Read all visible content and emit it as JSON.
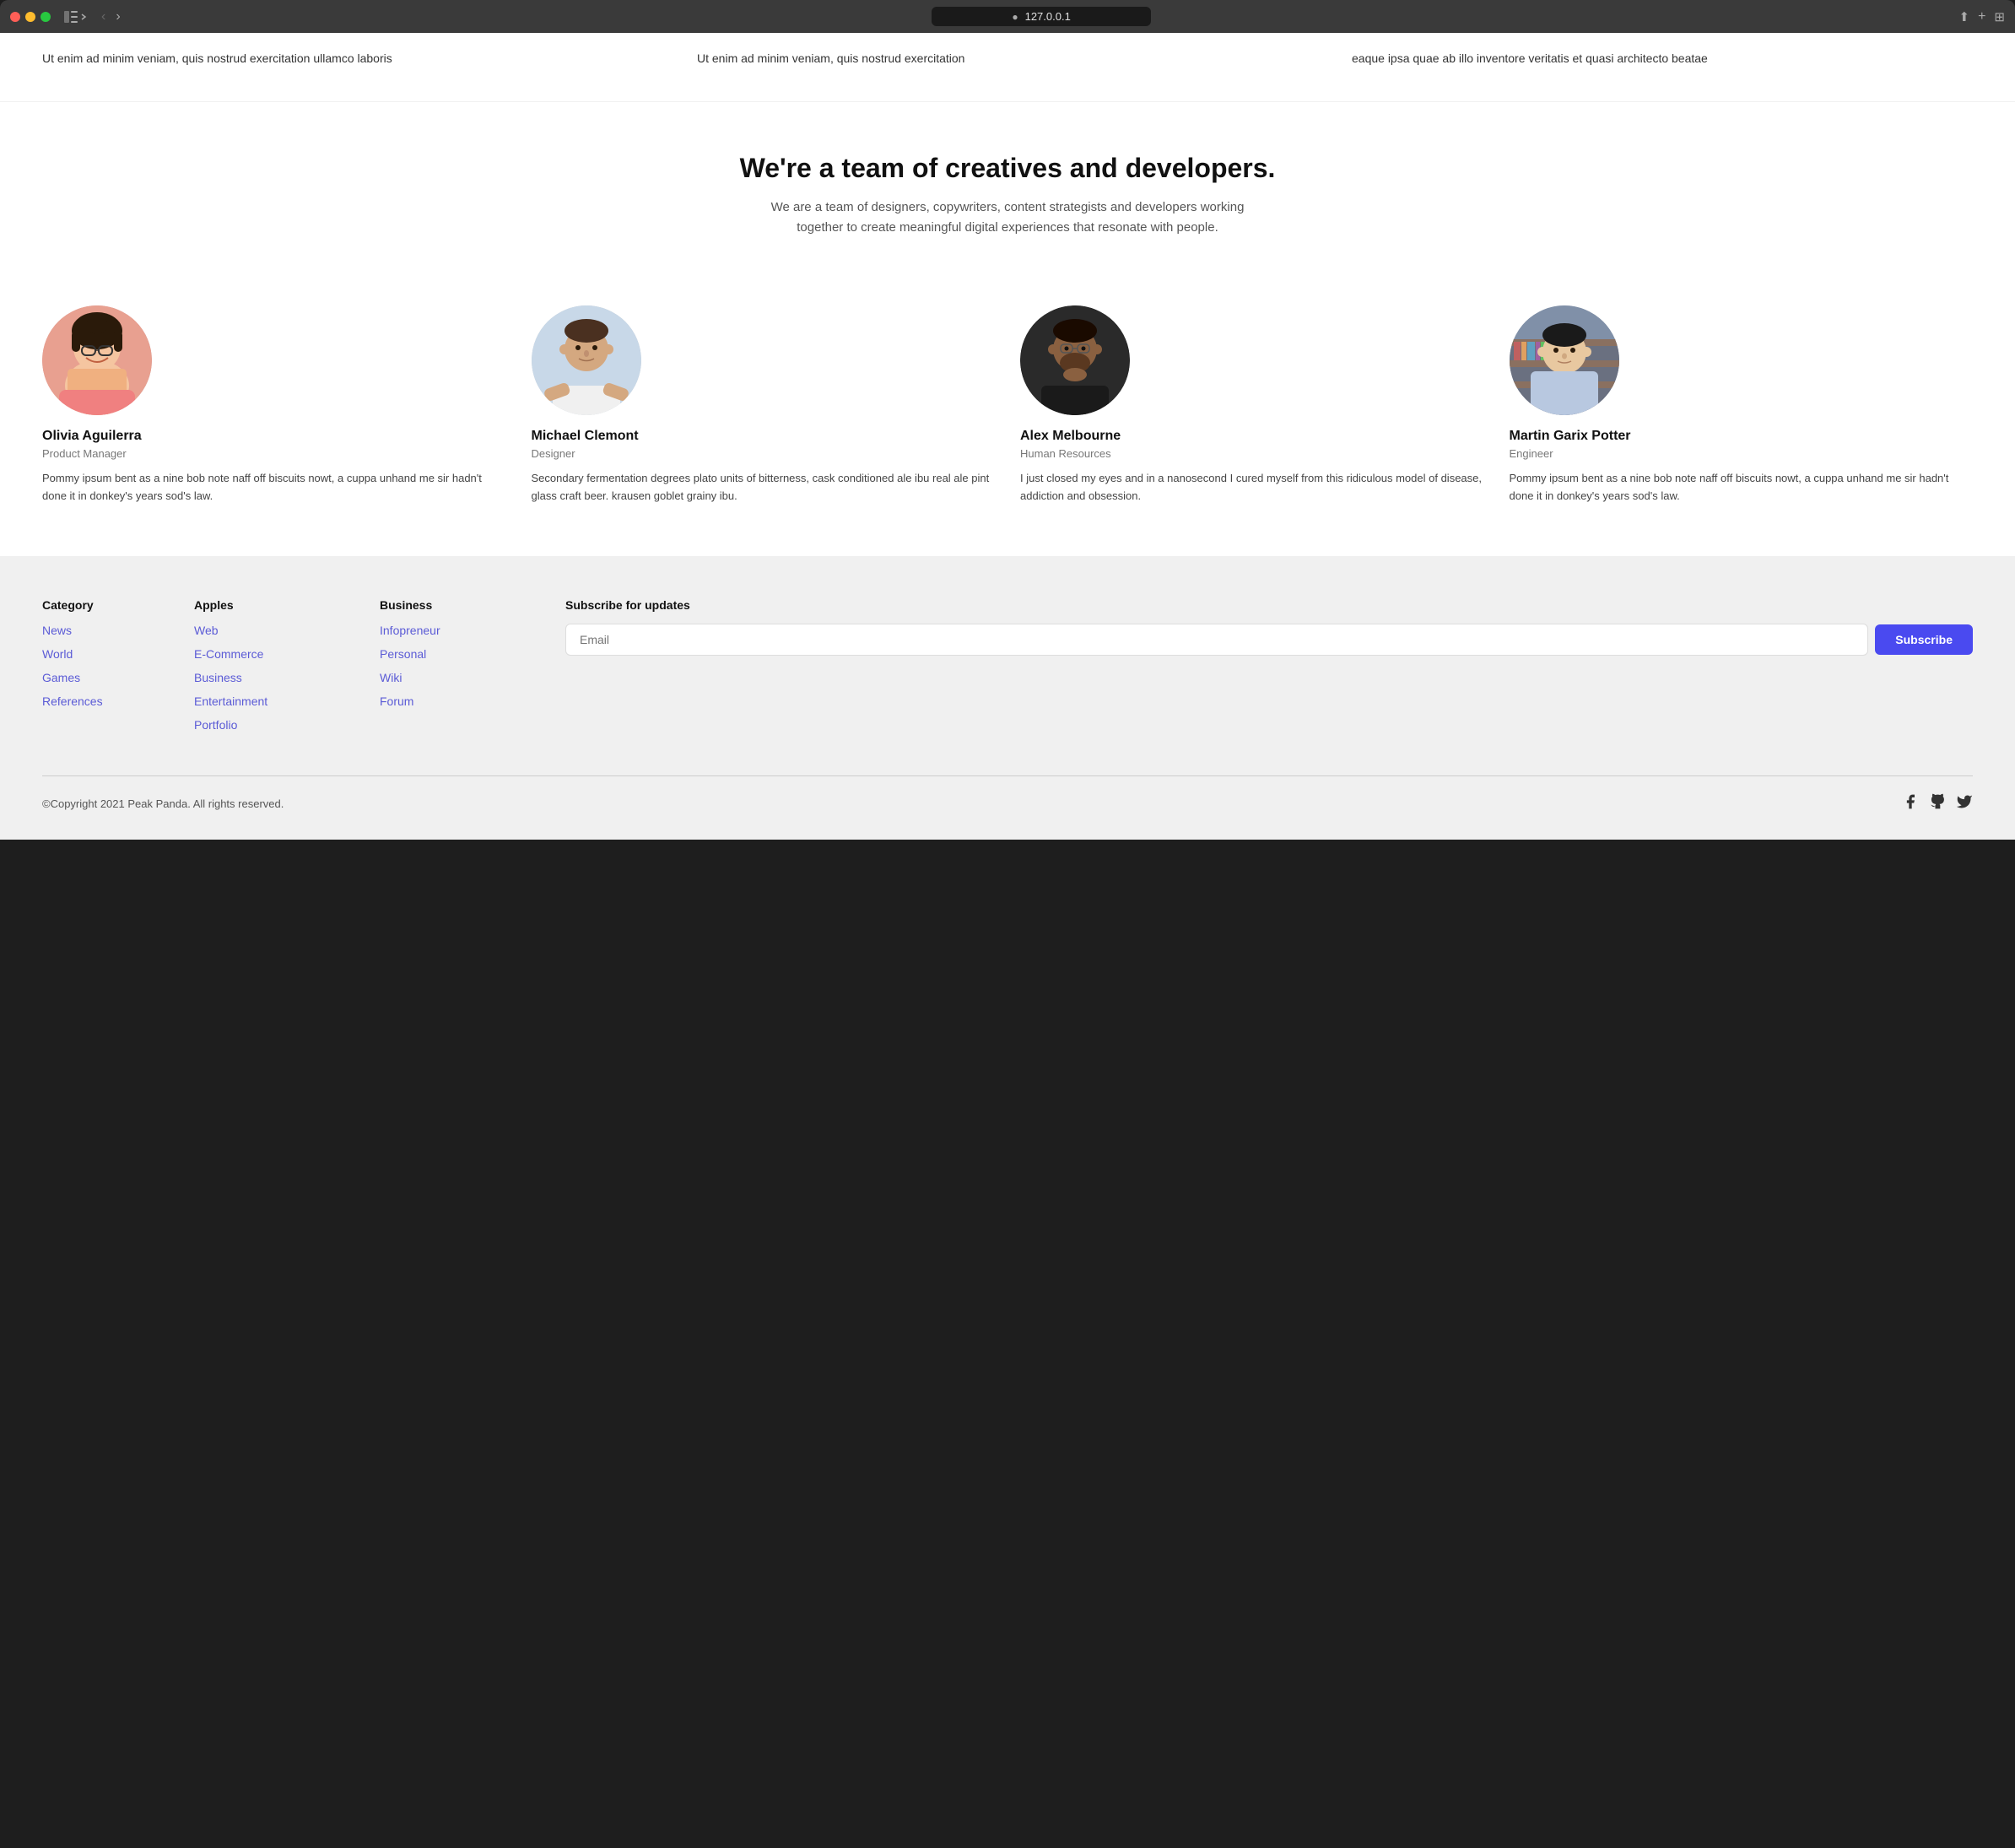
{
  "browser": {
    "url": "127.0.0.1",
    "traffic_lights": [
      "close",
      "minimize",
      "maximize"
    ]
  },
  "top_section": {
    "items": [
      {
        "text": "Ut enim ad minim veniam, quis nostrud exercitation ullamco laboris"
      },
      {
        "text": "Ut enim ad minim veniam, quis nostrud exercitation"
      },
      {
        "text": "eaque ipsa quae ab illo inventore veritatis et quasi architecto beatae"
      }
    ]
  },
  "team_section": {
    "heading": "We're a team of creatives and developers.",
    "subtitle": "We are a team of designers, copywriters, content strategists and developers working together to create meaningful digital experiences that resonate with people.",
    "members": [
      {
        "name": "Olivia Aguilerra",
        "role": "Product Manager",
        "bio": "Pommy ipsum bent as a nine bob note naff off biscuits nowt, a cuppa unhand me sir hadn't done it in donkey's years sod's law.",
        "avatar_class": "avatar-olivia",
        "initials": ""
      },
      {
        "name": "Michael Clemont",
        "role": "Designer",
        "bio": "Secondary fermentation degrees plato units of bitterness, cask conditioned ale ibu real ale pint glass craft beer. krausen goblet grainy ibu.",
        "avatar_class": "avatar-michael",
        "initials": ""
      },
      {
        "name": "Alex Melbourne",
        "role": "Human Resources",
        "bio": "I just closed my eyes and in a nanosecond I cured myself from this ridiculous model of disease, addiction and obsession.",
        "avatar_class": "avatar-alex",
        "initials": ""
      },
      {
        "name": "Martin Garix Potter",
        "role": "Engineer",
        "bio": "Pommy ipsum bent as a nine bob note naff off biscuits nowt, a cuppa unhand me sir hadn't done it in donkey's years sod's law.",
        "avatar_class": "avatar-martin",
        "initials": ""
      }
    ]
  },
  "footer": {
    "columns": [
      {
        "heading": "Category",
        "links": [
          "News",
          "World",
          "Games",
          "References"
        ]
      },
      {
        "heading": "Apples",
        "links": [
          "Web",
          "E-Commerce",
          "Business",
          "Entertainment",
          "Portfolio"
        ]
      },
      {
        "heading": "Business",
        "links": [
          "Infopreneur",
          "Personal",
          "Wiki",
          "Forum"
        ]
      }
    ],
    "subscribe": {
      "heading": "Subscribe for updates",
      "placeholder": "Email",
      "button_label": "Subscribe"
    },
    "copyright": "©Copyright 2021 Peak Panda. All rights reserved.",
    "social_icons": [
      "facebook",
      "github",
      "twitter"
    ]
  }
}
